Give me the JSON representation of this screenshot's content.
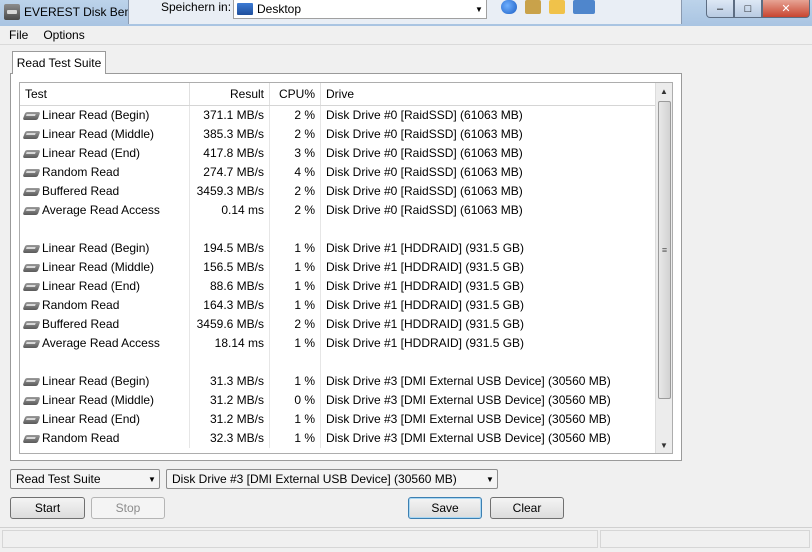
{
  "window": {
    "title": "EVEREST Disk Benc",
    "dialog_save_in_label": "Speichern in:",
    "dialog_location": "Desktop"
  },
  "menu": {
    "file": "File",
    "options": "Options"
  },
  "tab": {
    "label": "Read Test Suite"
  },
  "table": {
    "headers": {
      "test": "Test",
      "result": "Result",
      "cpu": "CPU%",
      "drive": "Drive"
    },
    "rows": [
      {
        "test": "Linear Read (Begin)",
        "result": "371.1 MB/s",
        "cpu": "2 %",
        "drive": "Disk Drive #0  [RaidSSD]  (61063 MB)"
      },
      {
        "test": "Linear Read (Middle)",
        "result": "385.3 MB/s",
        "cpu": "2 %",
        "drive": "Disk Drive #0  [RaidSSD]  (61063 MB)"
      },
      {
        "test": "Linear Read (End)",
        "result": "417.8 MB/s",
        "cpu": "3 %",
        "drive": "Disk Drive #0  [RaidSSD]  (61063 MB)"
      },
      {
        "test": "Random Read",
        "result": "274.7 MB/s",
        "cpu": "4 %",
        "drive": "Disk Drive #0  [RaidSSD]  (61063 MB)"
      },
      {
        "test": "Buffered Read",
        "result": "3459.3 MB/s",
        "cpu": "2 %",
        "drive": "Disk Drive #0  [RaidSSD]  (61063 MB)"
      },
      {
        "test": "Average Read Access",
        "result": "0.14 ms",
        "cpu": "2 %",
        "drive": "Disk Drive #0  [RaidSSD]  (61063 MB)"
      },
      {
        "test": "",
        "result": "",
        "cpu": "",
        "drive": ""
      },
      {
        "test": "Linear Read (Begin)",
        "result": "194.5 MB/s",
        "cpu": "1 %",
        "drive": "Disk Drive #1  [HDDRAID]  (931.5 GB)"
      },
      {
        "test": "Linear Read (Middle)",
        "result": "156.5 MB/s",
        "cpu": "1 %",
        "drive": "Disk Drive #1  [HDDRAID]  (931.5 GB)"
      },
      {
        "test": "Linear Read (End)",
        "result": "88.6 MB/s",
        "cpu": "1 %",
        "drive": "Disk Drive #1  [HDDRAID]  (931.5 GB)"
      },
      {
        "test": "Random Read",
        "result": "164.3 MB/s",
        "cpu": "1 %",
        "drive": "Disk Drive #1  [HDDRAID]  (931.5 GB)"
      },
      {
        "test": "Buffered Read",
        "result": "3459.6 MB/s",
        "cpu": "2 %",
        "drive": "Disk Drive #1  [HDDRAID]  (931.5 GB)"
      },
      {
        "test": "Average Read Access",
        "result": "18.14 ms",
        "cpu": "1 %",
        "drive": "Disk Drive #1  [HDDRAID]  (931.5 GB)"
      },
      {
        "test": "",
        "result": "",
        "cpu": "",
        "drive": ""
      },
      {
        "test": "Linear Read (Begin)",
        "result": "31.3 MB/s",
        "cpu": "1 %",
        "drive": "Disk Drive #3  [DMI External USB Device]  (30560 MB)"
      },
      {
        "test": "Linear Read (Middle)",
        "result": "31.2 MB/s",
        "cpu": "0 %",
        "drive": "Disk Drive #3  [DMI External USB Device]  (30560 MB)"
      },
      {
        "test": "Linear Read (End)",
        "result": "31.2 MB/s",
        "cpu": "1 %",
        "drive": "Disk Drive #3  [DMI External USB Device]  (30560 MB)"
      },
      {
        "test": "Random Read",
        "result": "32.3 MB/s",
        "cpu": "1 %",
        "drive": "Disk Drive #3  [DMI External USB Device]  (30560 MB)"
      }
    ]
  },
  "controls": {
    "suite_selected": "Read Test Suite",
    "drive_selected": "Disk Drive #3  [DMI External USB Device]  (30560 MB)",
    "start": "Start",
    "stop": "Stop",
    "save": "Save",
    "clear": "Clear"
  },
  "icons": {
    "app": "disk-icon",
    "row": "hard-disk-icon",
    "location": "desktop-folder-icon"
  }
}
